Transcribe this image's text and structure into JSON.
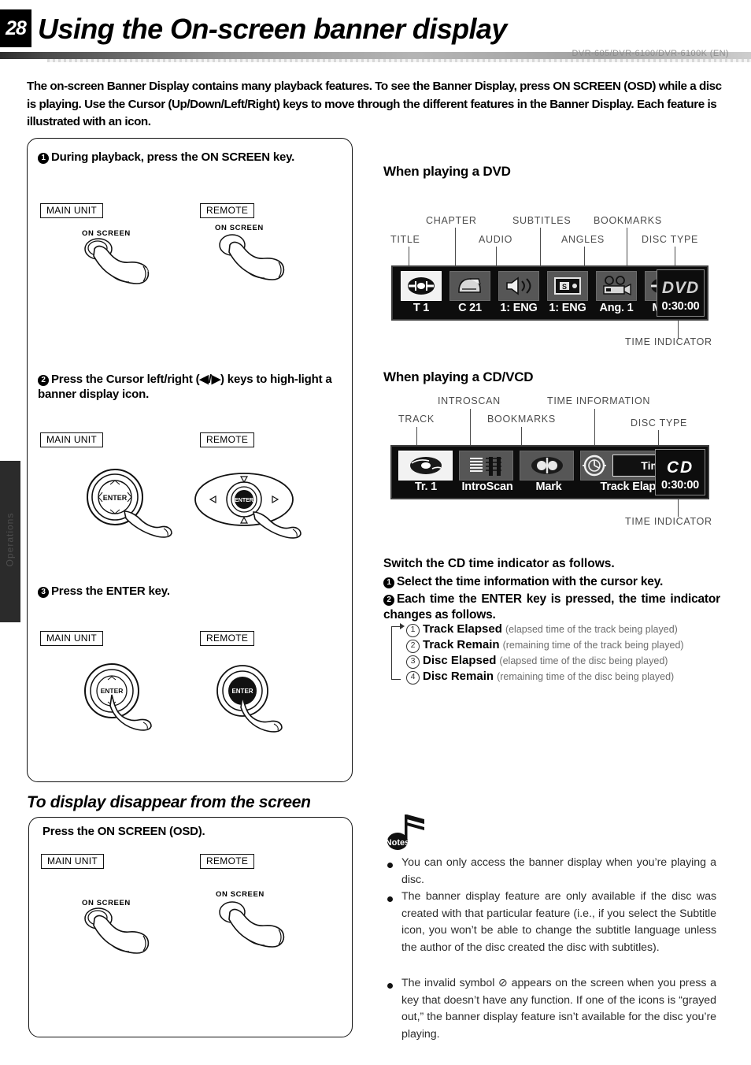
{
  "page": {
    "number": "28",
    "title": "Using the On-screen banner display",
    "model_line": "DVR-605/DVR-6100/DVR-6100K (EN)",
    "side_tab_label": "Operations"
  },
  "intro": "The on-screen Banner Display contains many playback features. To see the Banner Display, press ON SCREEN (OSD) while a disc is playing. Use the Cursor (Up/Down/Left/Right) keys to move through the different features in the Banner Display. Each feature is illustrated with an icon.",
  "steps": [
    {
      "num": "1",
      "text": "During playback, press  the ON SCREEN key.",
      "main_unit_tag": "MAIN UNIT",
      "remote_tag": "REMOTE",
      "main_unit_button": "ON SCREEN",
      "remote_button": "ON SCREEN"
    },
    {
      "num": "2",
      "text": "Press the Cursor left/right (◀/▶) keys to high-light a banner display icon.",
      "main_unit_tag": "MAIN UNIT",
      "remote_tag": "REMOTE",
      "main_unit_button": "ENTER",
      "remote_button": "ENTER"
    },
    {
      "num": "3",
      "text": "Press the ENTER key.",
      "main_unit_tag": "MAIN UNIT",
      "remote_tag": "REMOTE",
      "main_unit_button": "ENTER",
      "remote_button": "ENTER"
    }
  ],
  "dvd_section": {
    "heading": "When playing a DVD",
    "callouts": [
      "TITLE",
      "CHAPTER",
      "AUDIO",
      "SUBTITLES",
      "ANGLES",
      "BOOKMARKS",
      "DISC TYPE"
    ],
    "time_indicator_label": "TIME INDICATOR",
    "icons": [
      "title-disc-icon",
      "chapter-icon",
      "audio-speaker-icon",
      "subtitles-icon",
      "angles-camera-icon",
      "bookmarks-icon"
    ],
    "values": [
      "T  1",
      "C  21",
      "1: ENG",
      "1: ENG",
      "Ang. 1",
      "Mark"
    ],
    "disc_type": "DVD",
    "time_value": "0:30:00"
  },
  "cd_section": {
    "heading": "When playing a CD/VCD",
    "callouts": [
      "TRACK",
      "INTROSCAN",
      "BOOKMARKS",
      "TIME INFORMATION",
      "DISC TYPE"
    ],
    "time_indicator_label": "TIME INDICATOR",
    "icons": [
      "track-disc-icon",
      "introscan-icon",
      "bookmarks-icon",
      "time-clock-icon"
    ],
    "values": [
      "Tr.  1",
      "IntroScan",
      "Mark",
      "Track Elapsed"
    ],
    "time_button_label": "Time",
    "disc_type": "CD",
    "time_value": "0:30:00"
  },
  "switch_section": {
    "heading": "Switch the CD time indicator as follows.",
    "step1": "Select the time information with the cursor key.",
    "step2": "Each time the ENTER key is pressed, the time indicator changes as follows.",
    "cycle": [
      {
        "num": "1",
        "label": "Track Elapsed",
        "desc": "(elapsed time of the track being played)"
      },
      {
        "num": "2",
        "label": "Track Remain",
        "desc": "(remaining time of the track being played)"
      },
      {
        "num": "3",
        "label": "Disc Elapsed",
        "desc": "(elapsed time of the disc being played)"
      },
      {
        "num": "4",
        "label": "Disc Remain",
        "desc": "(remaining time of the disc being played)"
      }
    ]
  },
  "notes": {
    "title": "Notes",
    "items": [
      "You can only access the banner display when you’re playing a disc.",
      "The banner display feature are only available if the disc was created with that particular feature (i.e., if you select the Subtitle icon, you won’t be able to change the subtitle language unless the author of the disc created the disc with subtitles).",
      "The invalid symbol ⊘ appears on the screen when you press a key that doesn’t have any function. If one of the icons is “grayed out,” the banner display feature isn’t available for the disc you’re playing."
    ]
  },
  "disappear_section": {
    "heading": "To display disappear from the screen",
    "instruction": "Press the ON SCREEN (OSD).",
    "main_unit_tag": "MAIN UNIT",
    "remote_tag": "REMOTE",
    "main_unit_button": "ON SCREEN",
    "remote_button": "ON SCREEN"
  }
}
